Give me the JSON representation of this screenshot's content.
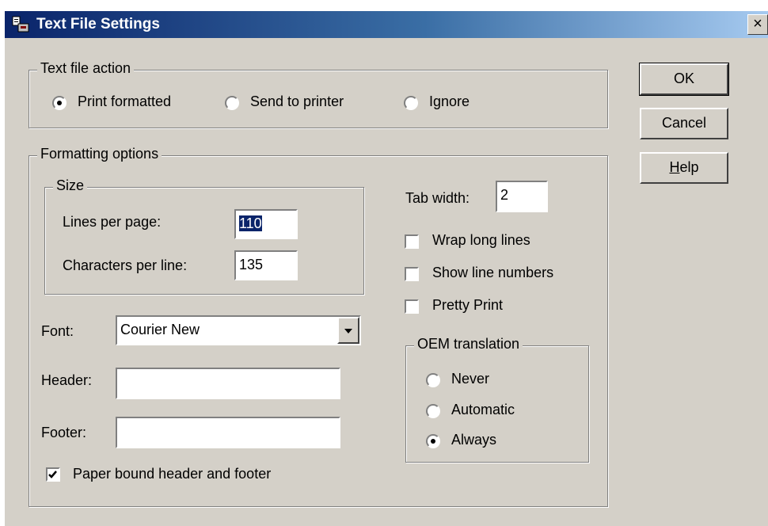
{
  "window": {
    "title": "Text File Settings",
    "close_glyph": "×"
  },
  "text_file_action": {
    "legend": "Text file action",
    "options": [
      {
        "label": "Print formatted",
        "selected": true
      },
      {
        "label": "Send to printer",
        "selected": false
      },
      {
        "label": "Ignore",
        "selected": false
      }
    ]
  },
  "buttons": {
    "ok": "OK",
    "cancel": "Cancel",
    "help_mnemonic": "H",
    "help_rest": "elp"
  },
  "formatting": {
    "legend": "Formatting options",
    "size": {
      "legend": "Size",
      "lines_per_page_label": "Lines per page:",
      "lines_per_page_value": "110",
      "chars_per_line_label": "Characters per line:",
      "chars_per_line_value": "135"
    },
    "tab_width_label": "Tab width:",
    "tab_width_value": "2",
    "checkboxes": [
      {
        "label": "Wrap long lines",
        "checked": false
      },
      {
        "label": "Show line numbers",
        "checked": false
      },
      {
        "label": "Pretty Print",
        "checked": false
      }
    ],
    "font_label": "Font:",
    "font_value": "Courier New",
    "header_label": "Header:",
    "header_value": "",
    "footer_label": "Footer:",
    "footer_value": "",
    "paper_bound_label": "Paper bound header and footer",
    "paper_bound_checked": true,
    "oem": {
      "legend": "OEM translation",
      "options": [
        {
          "label": "Never",
          "selected": false
        },
        {
          "label": "Automatic",
          "selected": false
        },
        {
          "label": "Always",
          "selected": true
        }
      ]
    }
  },
  "colors": {
    "titlebar_start": "#0a246a",
    "titlebar_end": "#a6caf0",
    "dialog_bg": "#d4d0c8"
  }
}
